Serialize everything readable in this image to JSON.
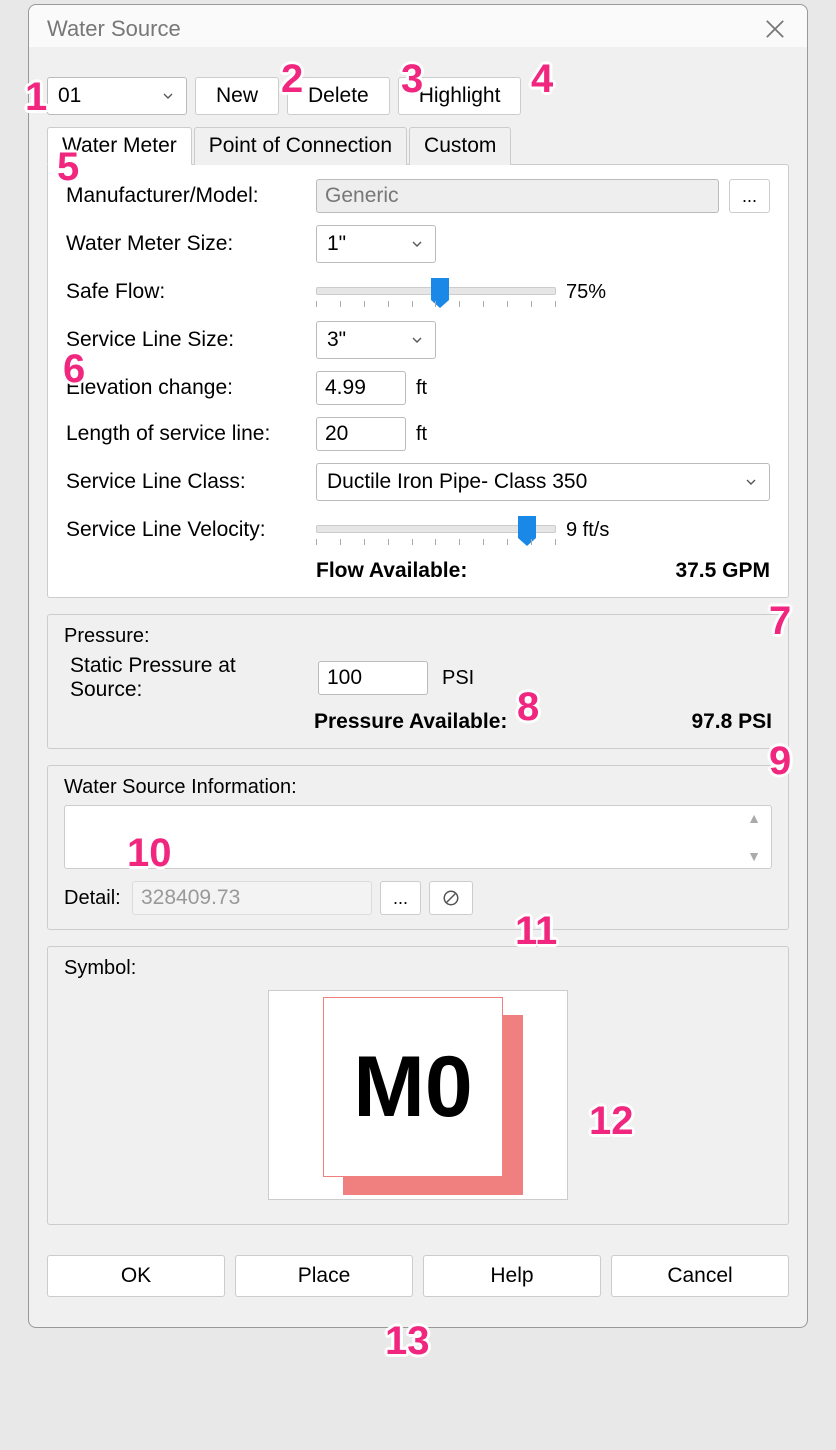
{
  "title": "Water Source",
  "toolbar": {
    "source_id": "01",
    "new_label": "New",
    "delete_label": "Delete",
    "highlight_label": "Highlight"
  },
  "tabs": {
    "water_meter": "Water Meter",
    "poc": "Point of Connection",
    "custom": "Custom"
  },
  "form": {
    "manufacturer_label": "Manufacturer/Model:",
    "manufacturer_value": "Generic",
    "ellipsis": "...",
    "meter_size_label": "Water Meter Size:",
    "meter_size_value": "1\"",
    "safe_flow_label": "Safe Flow:",
    "safe_flow_value": "75%",
    "service_line_size_label": "Service Line Size:",
    "service_line_size_value": "3\"",
    "elevation_label": "Elevation change:",
    "elevation_value": "4.99",
    "elevation_unit": "ft",
    "length_label": "Length of service line:",
    "length_value": "20",
    "length_unit": "ft",
    "class_label": "Service Line Class:",
    "class_value": "Ductile Iron Pipe- Class 350",
    "velocity_label": "Service Line Velocity:",
    "velocity_value": "9 ft/s",
    "flow_available_label": "Flow Available:",
    "flow_available_value": "37.5 GPM"
  },
  "pressure": {
    "group_label": "Pressure:",
    "static_label": "Static Pressure at Source:",
    "static_value": "100",
    "static_unit": "PSI",
    "available_label": "Pressure Available:",
    "available_value": "97.8 PSI"
  },
  "info": {
    "group_label": "Water Source Information:",
    "detail_label": "Detail:",
    "detail_value": "328409.73",
    "ellipsis": "...",
    "cancel_icon": "⊘"
  },
  "symbol": {
    "group_label": "Symbol:",
    "text": "M0"
  },
  "footer": {
    "ok": "OK",
    "place": "Place",
    "help": "Help",
    "cancel": "Cancel"
  },
  "annotations": {
    "1": "1",
    "2": "2",
    "3": "3",
    "4": "4",
    "5": "5",
    "6": "6",
    "7": "7",
    "8": "8",
    "9": "9",
    "10": "10",
    "11": "11",
    "12": "12",
    "13": "13"
  }
}
